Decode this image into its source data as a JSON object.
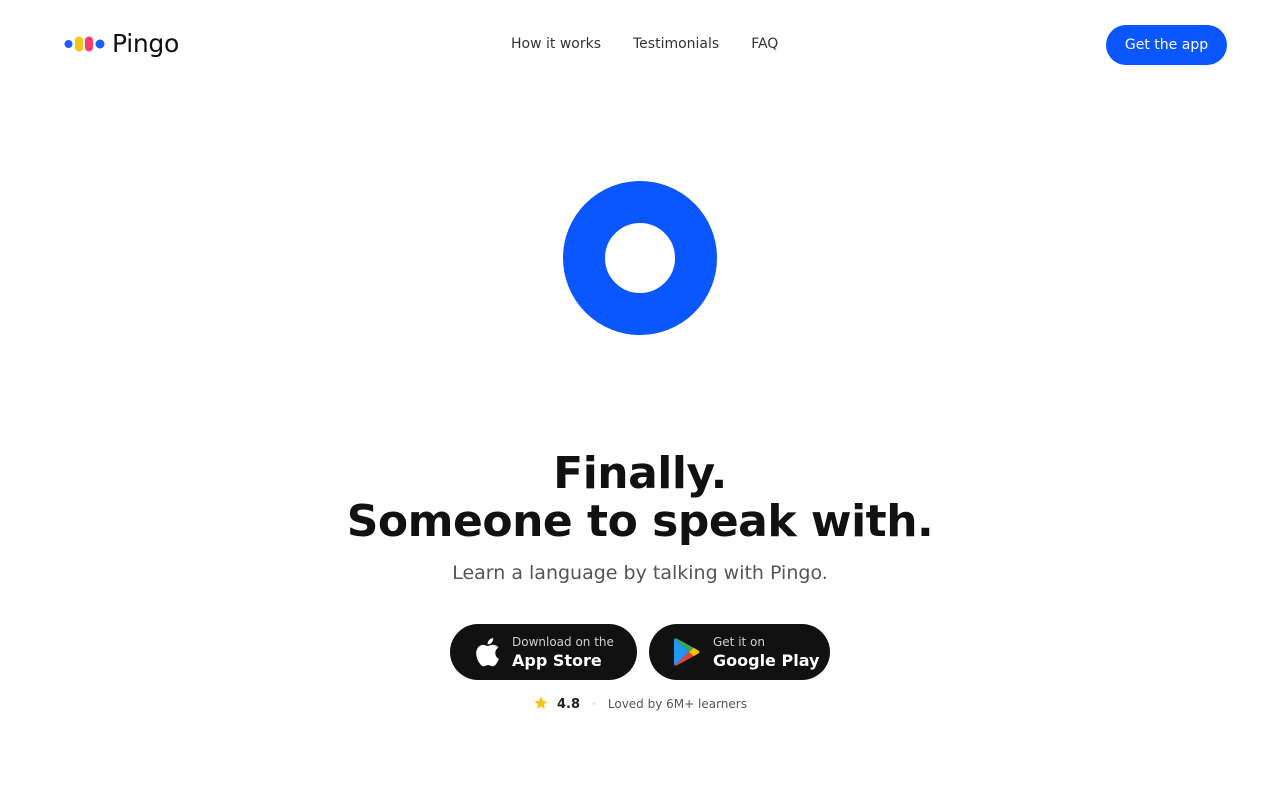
{
  "brand": {
    "name": "Pingo",
    "logo_colors": [
      "#1f5cff",
      "#f5c518",
      "#ff3b6b",
      "#1f5cff"
    ]
  },
  "nav": {
    "items": [
      {
        "label": "How it works"
      },
      {
        "label": "Testimonials"
      },
      {
        "label": "FAQ"
      }
    ],
    "cta_label": "Get the app"
  },
  "colors": {
    "accent": "#0a56ff",
    "ring": "#0a56ff",
    "dark": "#111111",
    "star": "#f5c518"
  },
  "hero": {
    "headline_line1": "Finally.",
    "headline_line2": "Someone to speak with.",
    "subheadline": "Learn a language by talking with Pingo."
  },
  "stores": {
    "apple": {
      "small": "Download on the",
      "big": "App Store",
      "icon": "apple-icon"
    },
    "google": {
      "small": "Get it on",
      "big": "Google Play",
      "icon": "google-play-icon"
    }
  },
  "rating": {
    "icon": "star-icon",
    "score": "4.8",
    "separator": "·",
    "text": "Loved by 6M+ learners"
  }
}
